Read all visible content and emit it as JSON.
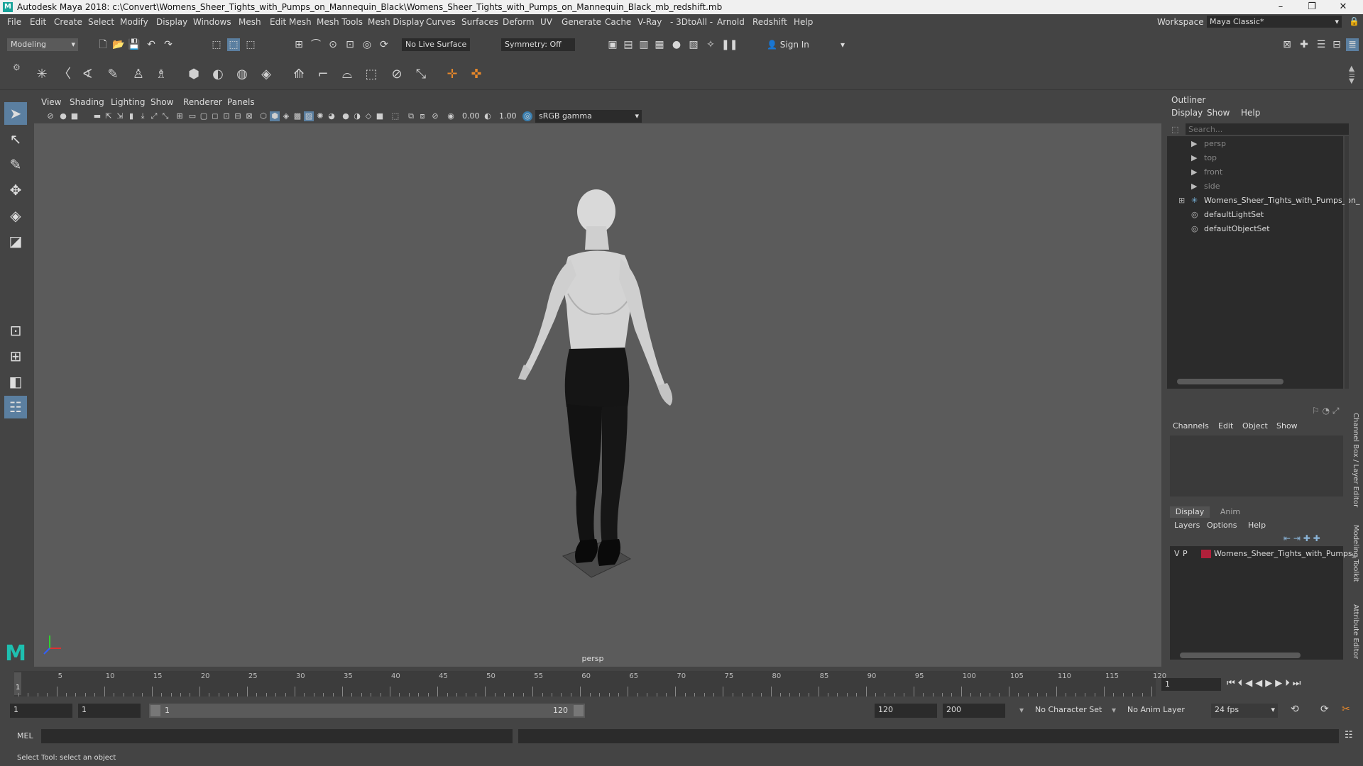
{
  "title_bar": {
    "logo_letter": "M",
    "title": "Autodesk Maya 2018: c:\\Convert\\Womens_Sheer_Tights_with_Pumps_on_Mannequin_Black\\Womens_Sheer_Tights_with_Pumps_on_Mannequin_Black_mb_redshift.mb",
    "minimize": "–",
    "maximize": "❐",
    "close": "✕"
  },
  "menu": {
    "items": [
      "File",
      "Edit",
      "Create",
      "Select",
      "Modify",
      "Display",
      "Windows",
      "Mesh",
      "Edit Mesh",
      "Mesh Tools",
      "Mesh Display",
      "Curves",
      "Surfaces",
      "Deform",
      "UV",
      "Generate",
      "Cache",
      "V-Ray",
      "- 3DtoAll -",
      "Arnold",
      "Redshift",
      "Help"
    ],
    "workspace_label": "Workspace :",
    "workspace_value": "Maya Classic*"
  },
  "toolbar": {
    "mode": "Modeling",
    "live_surface": "No Live Surface",
    "symmetry": "Symmetry: Off",
    "sign_in": "Sign In"
  },
  "viewport": {
    "menu": [
      "View",
      "Shading",
      "Lighting",
      "Show",
      "Renderer",
      "Panels"
    ],
    "exposure": "0.00",
    "gamma": "1.00",
    "color_space": "sRGB gamma",
    "camera_label": "persp",
    "background_color": "#5b5b5b"
  },
  "outliner": {
    "title": "Outliner",
    "menu": [
      "Display",
      "Show",
      "Help"
    ],
    "search_placeholder": "Search...",
    "items": [
      {
        "label": "persp",
        "icon": "camera-icon",
        "dim": true
      },
      {
        "label": "top",
        "icon": "camera-icon",
        "dim": true
      },
      {
        "label": "front",
        "icon": "camera-icon",
        "dim": true
      },
      {
        "label": "side",
        "icon": "camera-icon",
        "dim": true
      },
      {
        "label": "Womens_Sheer_Tights_with_Pumps_on_",
        "icon": "transform-icon",
        "dim": false
      },
      {
        "label": "defaultLightSet",
        "icon": "set-icon",
        "dim": false
      },
      {
        "label": "defaultObjectSet",
        "icon": "set-icon",
        "dim": false
      }
    ]
  },
  "channel_box": {
    "menu": [
      "Channels",
      "Edit",
      "Object",
      "Show"
    ]
  },
  "layer_editor": {
    "tabs": [
      "Display",
      "Anim"
    ],
    "menu": [
      "Layers",
      "Options",
      "Help"
    ],
    "layer": {
      "v": "V",
      "p": "P",
      "name": "Womens_Sheer_Tights_with_Pumps_",
      "color": "#b0203a"
    }
  },
  "side_tabs": [
    "Channel Box / Layer Editor",
    "Modeling Toolkit",
    "Attribute Editor"
  ],
  "timeline": {
    "ticks": [
      "5",
      "10",
      "15",
      "20",
      "25",
      "30",
      "35",
      "40",
      "45",
      "50",
      "55",
      "60",
      "65",
      "70",
      "75",
      "80",
      "85",
      "90",
      "95",
      "100",
      "105",
      "110",
      "115",
      "120"
    ],
    "current_frame_marker": "1",
    "current_frame_field": "1"
  },
  "range": {
    "start": "1",
    "playback_start": "1",
    "slider_start": "1",
    "slider_end": "120",
    "playback_end": "120",
    "end": "200",
    "character_set": "No Character Set",
    "anim_layer": "No Anim Layer",
    "fps": "24 fps"
  },
  "command_line": {
    "label": "MEL"
  },
  "help_line": {
    "text": "Select Tool: select an object"
  }
}
